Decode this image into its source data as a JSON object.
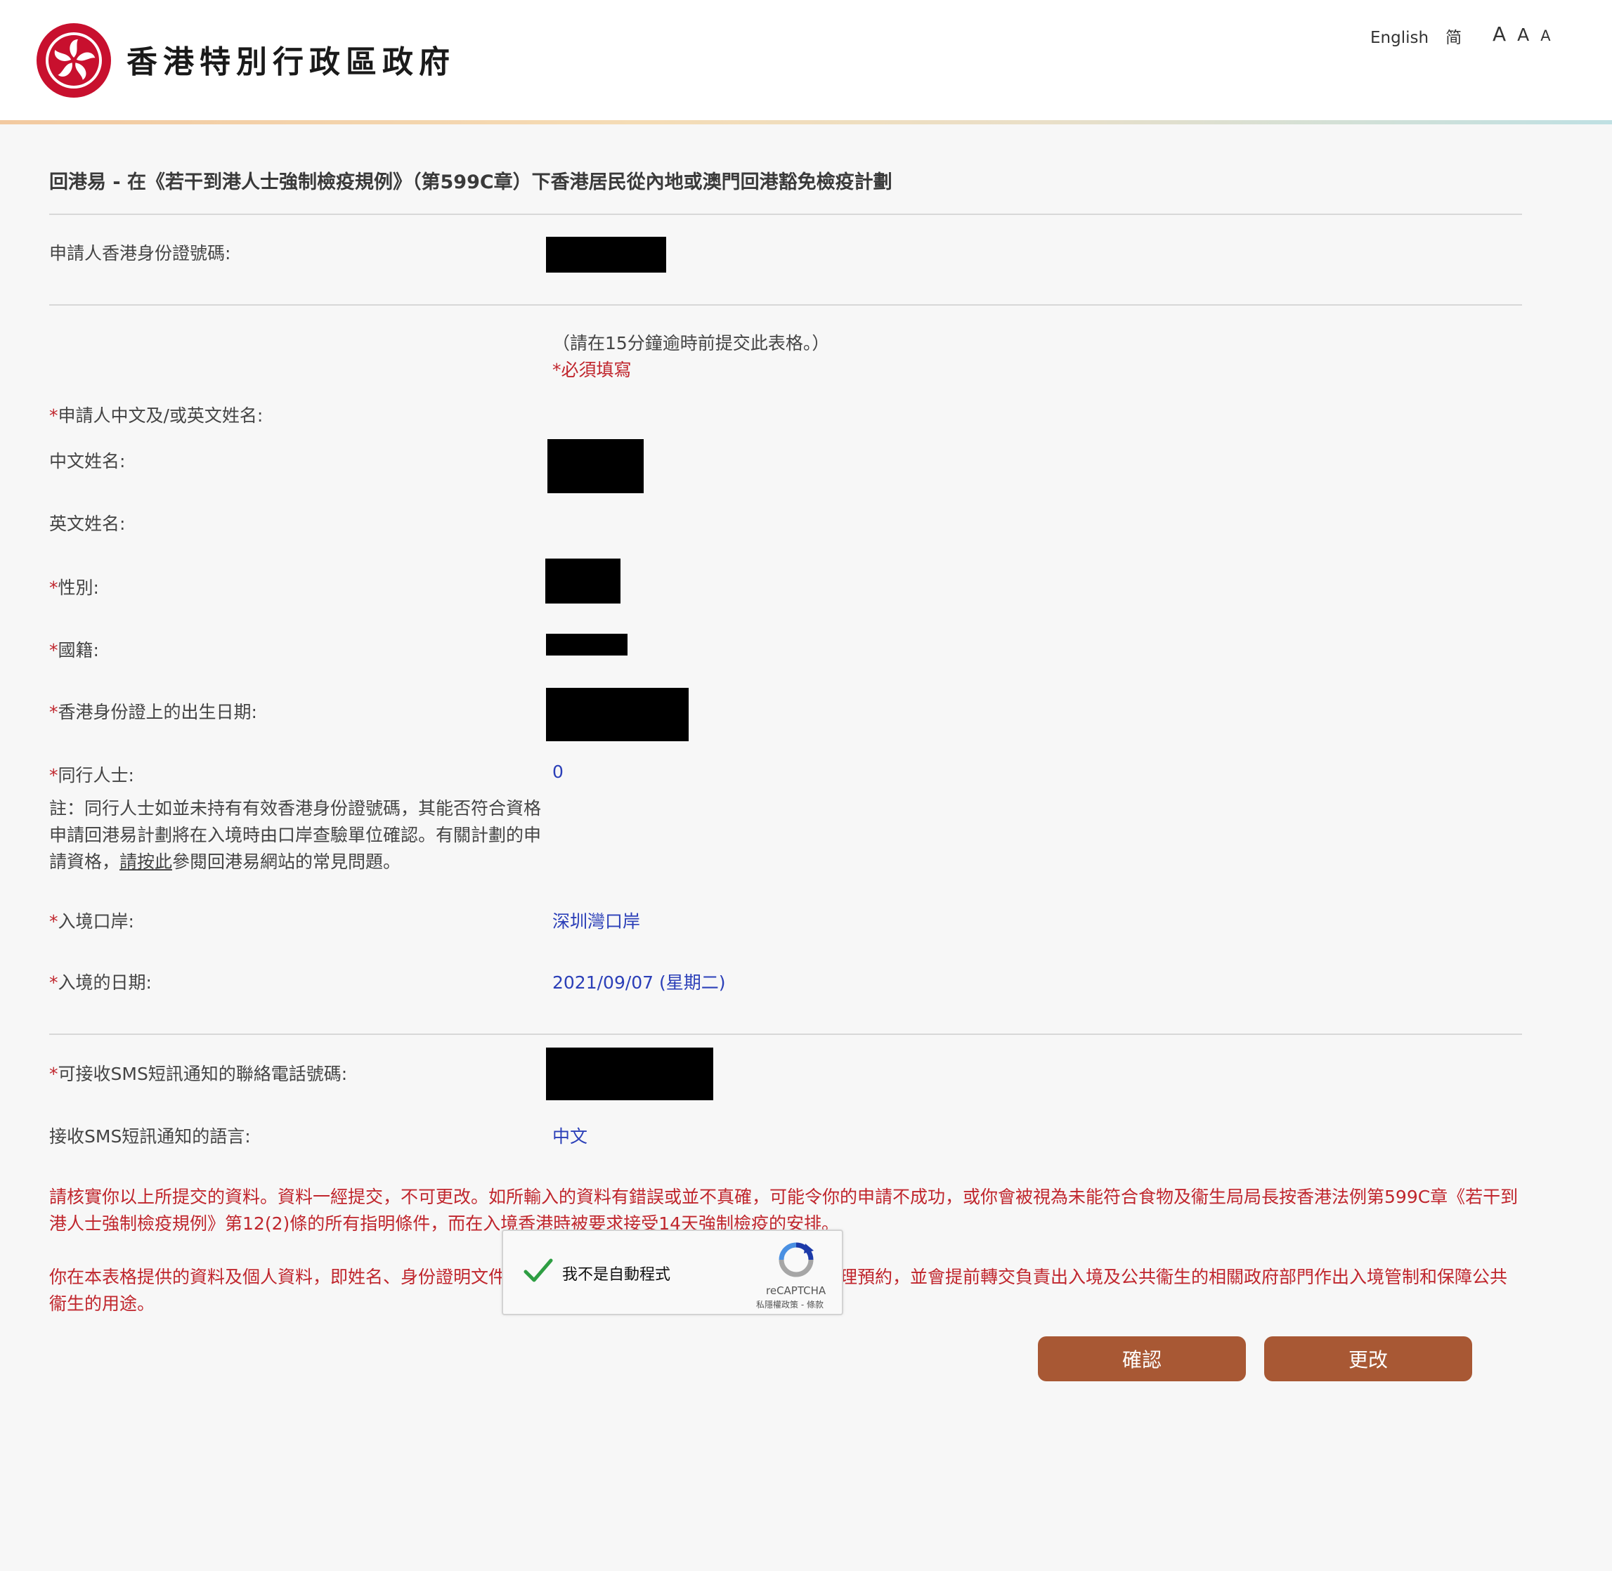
{
  "header": {
    "gov_title": "香港特別行政區政府",
    "lang_english": "English",
    "lang_simplified": "简",
    "font_large": "A",
    "font_medium": "A",
    "font_small": "A"
  },
  "page": {
    "title": "回港易 - 在《若干到港人士強制檢疫規例》（第599C章）下香港居民從內地或澳門回港豁免檢疫計劃"
  },
  "form": {
    "hkid_label": "申請人香港身份證號碼:",
    "time_note": "（請在15分鐘逾時前提交此表格。）",
    "required_note": "*必須填寫",
    "asterisk": "*",
    "name_label": "申請人中文及/或英文姓名:",
    "chinese_name_label": "中文姓名:",
    "english_name_label": "英文姓名:",
    "gender_label": "性別:",
    "nationality_label": "國籍:",
    "dob_label": "香港身份證上的出生日期:",
    "companions_label": "同行人士:",
    "companions_value": "0",
    "companion_note_before": "註：同行人士如並未持有有效香港身份證號碼，其能否符合資格申請回港易計劃將在入境時由口岸查驗單位確認。有關計劃的申請資格，",
    "companion_note_link": "請按此",
    "companion_note_after": "參閱回港易網站的常見問題。",
    "port_label": "入境口岸:",
    "port_value": "深圳灣口岸",
    "entry_date_label": "入境的日期:",
    "entry_date_value": "2021/09/07 (星期二)",
    "phone_label": "可接收SMS短訊通知的聯絡電話號碼:",
    "sms_lang_label": "接收SMS短訊通知的語言:",
    "sms_lang_value": "中文"
  },
  "warnings": {
    "verify": "請核實你以上所提交的資料。資料一經提交，不可更改。如所輸入的資料有錯誤或並不真確，可能令你的申請不成功，或你會被視為未能符合食物及衞生局局長按香港法例第599C章《若干到港人士強制檢疫規例》第12(2)條的所有指明條件，而在入境香港時被要求接受14天強制檢疫的安排。",
    "privacy": "你在本表格提供的資料及個人資料，即姓名、身份證明文件號碼及聯絡電話號碼，會用作登記及／或處理預約，並會提前轉交負責出入境及公共衞生的相關政府部門作出入境管制和保障公共衞生的用途。"
  },
  "recaptcha": {
    "label": "我不是自動程式",
    "brand": "reCAPTCHA",
    "terms": "私隱權政策 - 條款"
  },
  "buttons": {
    "confirm": "確認",
    "modify": "更改"
  },
  "colors": {
    "accent_button": "#a85834",
    "required_red": "#c0262d",
    "value_blue": "#2b3fb8"
  }
}
